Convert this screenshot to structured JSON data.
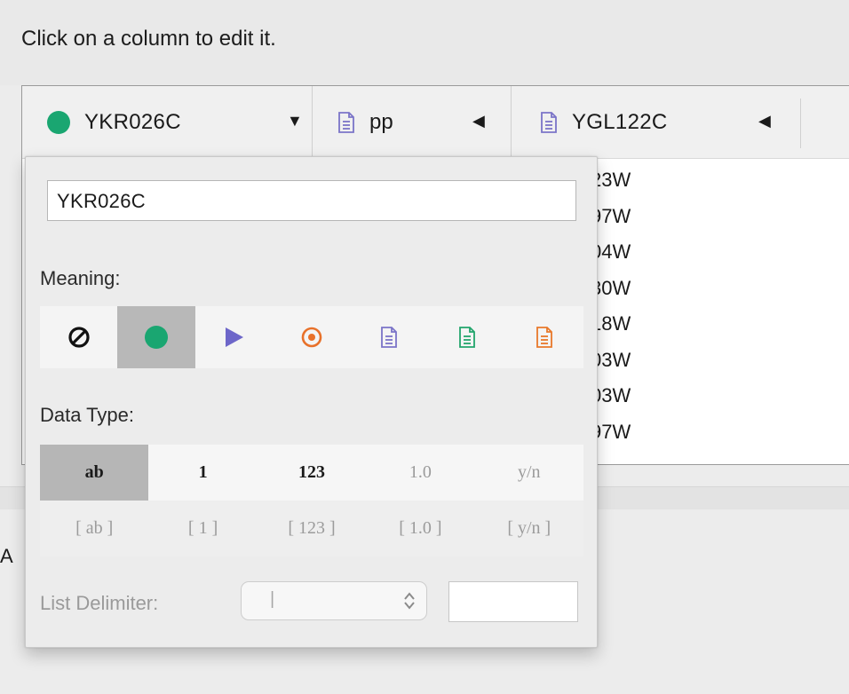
{
  "instruction": "Click on a column to edit it.",
  "fragment_left": "A",
  "columns": [
    {
      "label": "YKR026C",
      "icon": "green-dot-icon",
      "caret": "▼"
    },
    {
      "label": "pp",
      "icon": "document-icon",
      "caret": "◀"
    },
    {
      "label": "YGL122C",
      "icon": "document-icon",
      "caret": "◀"
    }
  ],
  "visible_cells": [
    "23W",
    "97W",
    "04W",
    "30W",
    "18W",
    "03W",
    "03W",
    "97W"
  ],
  "popup": {
    "name_value": "YKR026C",
    "meaning_label": "Meaning:",
    "meaning_options": [
      {
        "name": "none",
        "icon": "prohibited-icon"
      },
      {
        "name": "source",
        "icon": "green-dot-icon",
        "selected": true
      },
      {
        "name": "target",
        "icon": "purple-triangle-icon"
      },
      {
        "name": "interaction",
        "icon": "orange-target-icon"
      },
      {
        "name": "source-attribute",
        "icon": "purple-document-icon"
      },
      {
        "name": "edge-attribute",
        "icon": "green-document-icon"
      },
      {
        "name": "target-attribute",
        "icon": "orange-document-icon"
      }
    ],
    "data_type_label": "Data Type:",
    "data_types_row1": [
      "ab",
      "1",
      "123",
      "1.0",
      "y/n"
    ],
    "data_types_row2": [
      "[ ab ]",
      "[ 1 ]",
      "[ 123 ]",
      "[ 1.0 ]",
      "[ y/n ]"
    ],
    "selected_data_type": "ab",
    "list_delimiter_label": "List Delimiter:",
    "list_delimiter_value": "|",
    "list_delimiter_updown": "⌃⌄"
  },
  "colors": {
    "source_green": "#1aa671",
    "target_purple": "#6d66c9",
    "interaction_orange": "#e8712a",
    "doc_purple": "#7b74c8",
    "doc_green": "#22a56c",
    "doc_orange": "#e8782a"
  }
}
